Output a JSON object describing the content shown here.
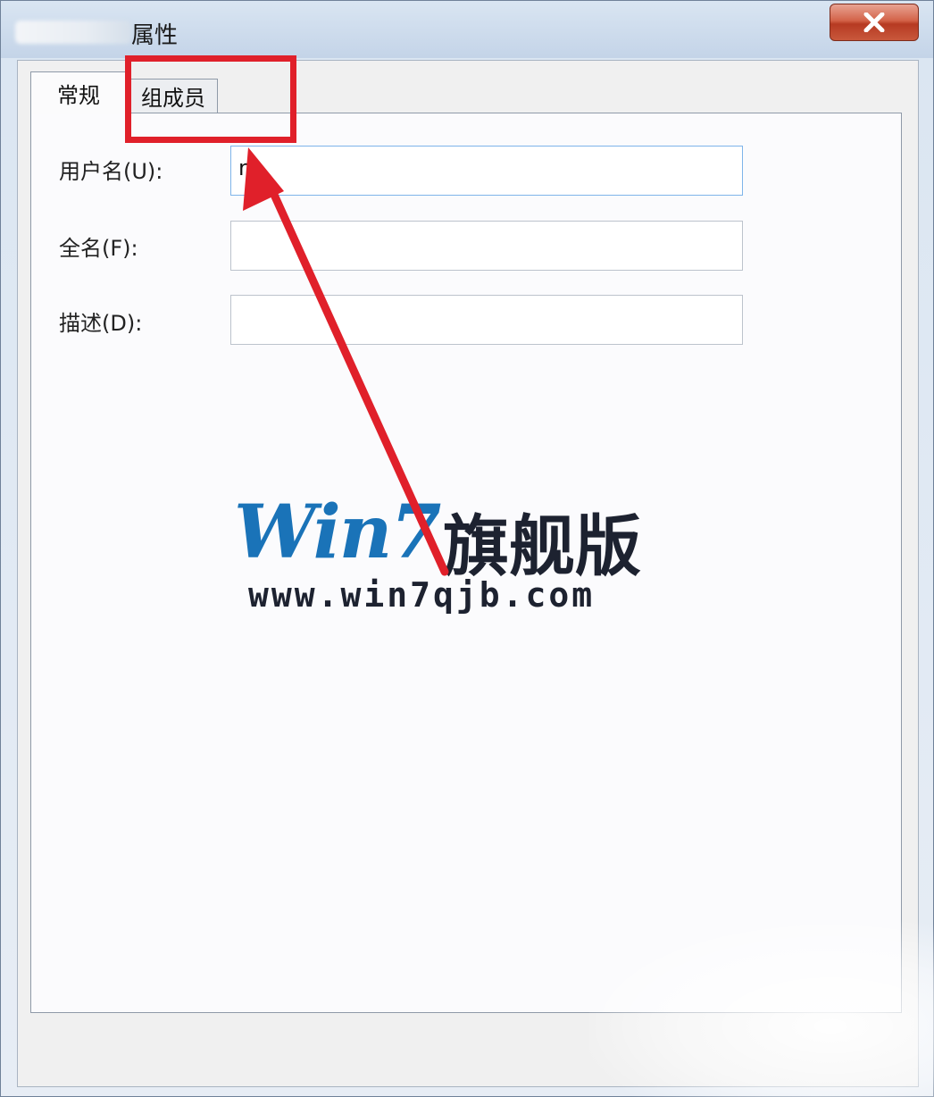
{
  "window": {
    "title_suffix": "属性",
    "close_label": "close"
  },
  "tabs": [
    {
      "label": "常规",
      "active": true
    },
    {
      "label": "组成员",
      "active": false
    }
  ],
  "form": {
    "username_label": "用户名(U):",
    "username_value": "n",
    "fullname_label": "全名(F):",
    "fullname_value": "",
    "description_label": "描述(D):",
    "description_value": ""
  },
  "annotation": {
    "highlight_color": "#e0202a",
    "target": "组成员 tab"
  },
  "watermark": {
    "brand": "Win7",
    "name": "旗舰版",
    "url": "www.win7qjb.com",
    "brand_color": "#1a73b8"
  }
}
